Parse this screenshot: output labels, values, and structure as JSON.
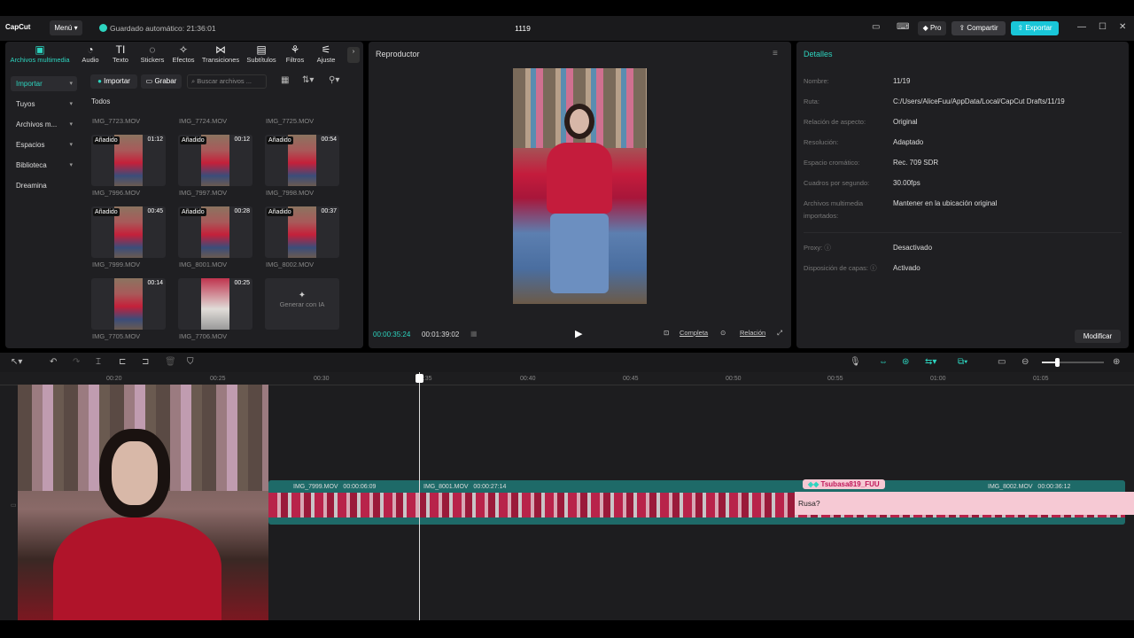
{
  "titlebar": {
    "logo": "CapCut",
    "menu": "Menú",
    "autosave": "Guardado automático: 21:36:01",
    "project": "1119",
    "pro": "Pro",
    "share": "Compartir",
    "export": "Exportar"
  },
  "toolbar": [
    {
      "label": "Archivos multimedia",
      "icon": "media-icon"
    },
    {
      "label": "Audio",
      "icon": "audio-icon"
    },
    {
      "label": "Texto",
      "icon": "text-icon"
    },
    {
      "label": "Stickers",
      "icon": "sticker-icon"
    },
    {
      "label": "Efectos",
      "icon": "effects-icon"
    },
    {
      "label": "Transiciones",
      "icon": "transition-icon"
    },
    {
      "label": "Subtítulos",
      "icon": "subtitle-icon"
    },
    {
      "label": "Filtros",
      "icon": "filter-icon"
    },
    {
      "label": "Ajuste",
      "icon": "adjust-icon"
    }
  ],
  "sidenav": [
    {
      "label": "Importar",
      "active": true
    },
    {
      "label": "Tuyos"
    },
    {
      "label": "Archivos m..."
    },
    {
      "label": "Espacios"
    },
    {
      "label": "Biblioteca"
    },
    {
      "label": "Dreamina"
    }
  ],
  "media": {
    "import_btn": "Importar",
    "record_btn": "Grabar",
    "search_placeholder": "Buscar archivos ...",
    "all": "Todos",
    "top_names": [
      "IMG_7723.MOV",
      "IMG_7724.MOV",
      "IMG_7725.MOV"
    ],
    "items": [
      {
        "name": "IMG_7996.MOV",
        "tag": "Añadido",
        "dur": "01:12"
      },
      {
        "name": "IMG_7997.MOV",
        "tag": "Añadido",
        "dur": "00:12"
      },
      {
        "name": "IMG_7998.MOV",
        "tag": "Añadido",
        "dur": "00:54"
      },
      {
        "name": "IMG_7999.MOV",
        "tag": "Añadido",
        "dur": "00:45"
      },
      {
        "name": "IMG_8001.MOV",
        "tag": "Añadido",
        "dur": "00:28"
      },
      {
        "name": "IMG_8002.MOV",
        "tag": "Añadido",
        "dur": "00:37"
      },
      {
        "name": "IMG_7705.MOV",
        "tag": "",
        "dur": "00:14"
      },
      {
        "name": "IMG_7706.MOV",
        "tag": "",
        "dur": "00:25"
      }
    ],
    "generate_ai": "Generar con IA"
  },
  "player": {
    "title": "Reproductor",
    "current": "00:00:35:24",
    "total": "00:01:39:02",
    "full": "Completa",
    "ratio": "Relación"
  },
  "details": {
    "title": "Detalles",
    "rows": [
      {
        "label": "Nombre:",
        "value": "11/19"
      },
      {
        "label": "Ruta:",
        "value": "C:/Users/AliceFuu/AppData/Local/CapCut Drafts/11/19"
      },
      {
        "label": "Relación de aspecto:",
        "value": "Original"
      },
      {
        "label": "Resolución:",
        "value": "Adaptado"
      },
      {
        "label": "Espacio cromático:",
        "value": "Rec. 709 SDR"
      },
      {
        "label": "Cuadros por segundo:",
        "value": "30.00fps"
      },
      {
        "label": "Archivos multimedia importados:",
        "value": "Mantener en la ubicación original"
      },
      {
        "label": "Proxy:",
        "value": "Desactivado"
      },
      {
        "label": "Disposición de capas:",
        "value": "Activado"
      }
    ],
    "modify": "Modificar"
  },
  "timeline": {
    "ticks": [
      "00:20",
      "00:25",
      "00:30",
      "00:35",
      "00:40",
      "00:45",
      "00:50",
      "00:55",
      "01:00",
      "01:05"
    ],
    "clips": [
      {
        "name": "IMG_7999.MOV",
        "dur": "00:00:06:09"
      },
      {
        "name": "IMG_8001.MOV",
        "dur": "00:00:27:14"
      },
      {
        "name": "IMG_8002.MOV",
        "dur": "00:00:36:12"
      }
    ]
  },
  "chat": {
    "user": "Tsubasa819_FUU",
    "message": "Rusa?"
  }
}
